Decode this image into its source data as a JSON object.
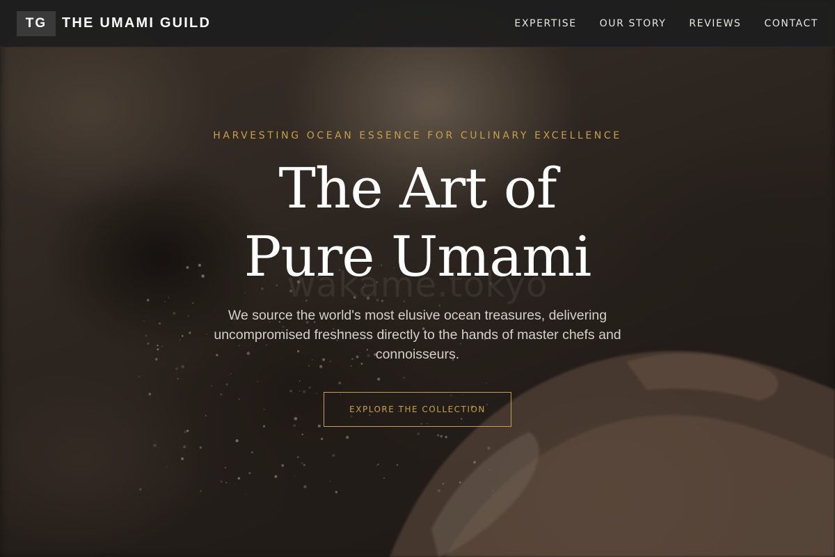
{
  "brand": {
    "mark": "TG",
    "name": "THE UMAMI GUILD"
  },
  "nav": {
    "links": [
      "EXPERTISE",
      "OUR STORY",
      "REVIEWS",
      "CONTACT"
    ]
  },
  "hero": {
    "eyebrow": "HARVESTING OCEAN ESSENCE FOR CULINARY EXCELLENCE",
    "headline_line1": "The Art of",
    "headline_line2": "Pure Umami",
    "watermark": "wakame.tokyo",
    "subtitle": "We source the world's most elusive ocean treasures, delivering uncompromised freshness directly to the hands of master chefs and connoisseurs.",
    "cta_label": "EXPLORE THE COLLECTION"
  },
  "colors": {
    "accent_gold": "#c8a04b",
    "nav_background": "#1e1e1e",
    "headline": "#ffffff",
    "body_text": "#d4d0ca"
  }
}
